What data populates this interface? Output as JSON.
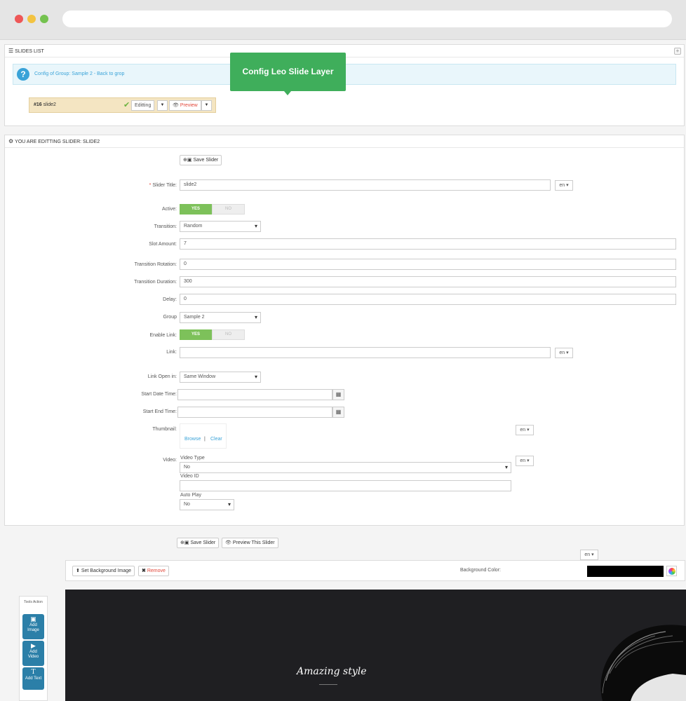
{
  "browser": {
    "dots": [
      "close",
      "minimize",
      "maximize"
    ]
  },
  "slides_list": {
    "title": "SLIDES LIST",
    "info_text": "Config of Group: Sample 2 - Back to grop",
    "tooltip": "Config Leo Slide Layer",
    "slide": {
      "id": "#16",
      "name": "slide2",
      "status_label": "Editting",
      "preview_label": "Preview"
    }
  },
  "editor": {
    "title": "YOU ARE EDITTING SLIDER: SLIDE2",
    "save_label": "Save Slider",
    "fields": {
      "slider_title": {
        "label": "Slider Title:",
        "value": "slide2",
        "lang": "en"
      },
      "active": {
        "label": "Active:",
        "yes": "YES",
        "no": "NO",
        "value": "YES"
      },
      "transition": {
        "label": "Transition:",
        "value": "Random"
      },
      "slot_amount": {
        "label": "Slot Amount:",
        "value": "7"
      },
      "transition_rotation": {
        "label": "Transition Rotation:",
        "value": "0"
      },
      "transition_duration": {
        "label": "Transition Duration:",
        "value": "300"
      },
      "delay": {
        "label": "Delay:",
        "value": "0"
      },
      "group": {
        "label": "Group",
        "value": "Sample 2"
      },
      "enable_link": {
        "label": "Enable Link:",
        "yes": "YES",
        "no": "NO",
        "value": "YES"
      },
      "link": {
        "label": "Link:",
        "value": "",
        "lang": "en"
      },
      "link_open_in": {
        "label": "Link Open in:",
        "value": "Same Window"
      },
      "start_date_time": {
        "label": "Start Date Time:",
        "value": ""
      },
      "start_end_time": {
        "label": "Start End Time:",
        "value": ""
      },
      "thumbnail": {
        "label": "Thumbnail:",
        "browse": "Browse",
        "separator": "|",
        "clear": "Clear",
        "lang": "en"
      },
      "video": {
        "label": "Video:",
        "lang": "en",
        "video_type_label": "Video Type",
        "video_type_value": "No",
        "video_id_label": "Video ID",
        "video_id_value": "",
        "auto_play_label": "Auto Play",
        "auto_play_value": "No"
      }
    }
  },
  "bottom": {
    "save_label": "Save Slider",
    "preview_label": "Preview This Slider",
    "lang": "en",
    "set_bg_label": "Set Background Image",
    "remove_label": "Remove",
    "bg_color_label": "Background Color:",
    "bg_color": "#000000"
  },
  "tools": {
    "title": "Tools Action",
    "add_image_line1": "Add",
    "add_image_line2": "Image",
    "add_video_line1": "Add",
    "add_video_line2": "Video",
    "add_text": "Add Text"
  },
  "stage": {
    "caption": "Amazing style"
  }
}
